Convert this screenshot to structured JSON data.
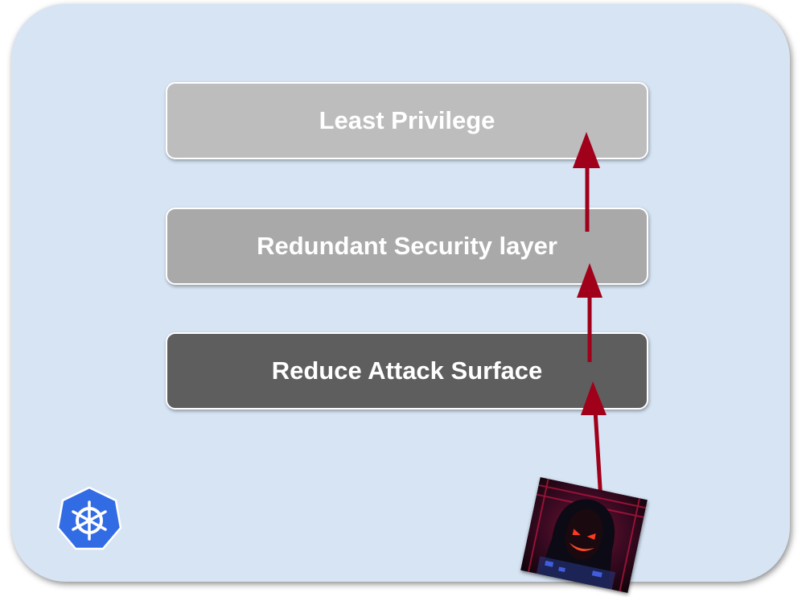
{
  "diagram": {
    "layers": [
      {
        "id": "top",
        "label": "Least Privilege",
        "color": "#bdbdbd"
      },
      {
        "id": "middle",
        "label": "Redundant Security layer",
        "color": "#a9a9a9"
      },
      {
        "id": "bottom",
        "label": "Reduce Attack Surface",
        "color": "#5e5e5e"
      }
    ],
    "arrow_color": "#a0001a",
    "panel_color": "#d6e4f4"
  },
  "logo": {
    "icon": "kubernetes-helm-wheel-icon",
    "color": "#326ce5"
  },
  "attacker": {
    "icon": "hooded-hacker-image"
  }
}
